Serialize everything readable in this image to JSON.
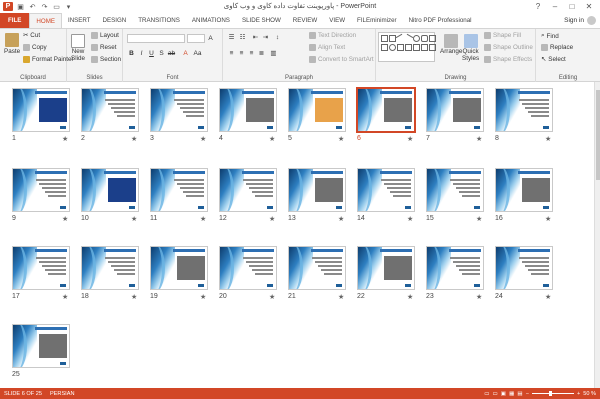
{
  "titlebar": {
    "app_icon": "P",
    "title": "پاورپوینت تفاوت داده کاوی و وب کاوی - PowerPoint",
    "window_controls": [
      "?",
      "–",
      "□",
      "✕"
    ]
  },
  "tabs": [
    {
      "label": "FILE"
    },
    {
      "label": "HOME"
    },
    {
      "label": "INSERT"
    },
    {
      "label": "DESIGN"
    },
    {
      "label": "TRANSITIONS"
    },
    {
      "label": "ANIMATIONS"
    },
    {
      "label": "SLIDE SHOW"
    },
    {
      "label": "REVIEW"
    },
    {
      "label": "VIEW"
    },
    {
      "label": "FILEminimizer"
    },
    {
      "label": "Nitro PDF Professional"
    }
  ],
  "signin": "Sign in",
  "ribbon": {
    "clipboard": {
      "paste": "Paste",
      "cut": "Cut",
      "copy": "Copy",
      "format_painter": "Format Painter",
      "label": "Clipboard"
    },
    "slides": {
      "new_slide": "New",
      "new_slide2": "Slide",
      "layout": "Layout",
      "reset": "Reset",
      "section": "Section",
      "label": "Slides"
    },
    "font": {
      "label": "Font"
    },
    "paragraph": {
      "text_direction": "Text Direction",
      "align_text": "Align Text",
      "convert": "Convert to SmartArt",
      "label": "Paragraph"
    },
    "drawing": {
      "arrange": "Arrange",
      "quick_styles": "Quick",
      "quick_styles2": "Styles",
      "shape_fill": "Shape Fill",
      "shape_outline": "Shape Outline",
      "shape_effects": "Shape Effects",
      "label": "Drawing"
    },
    "editing": {
      "find": "Find",
      "replace": "Replace",
      "select": "Select",
      "label": "Editing"
    }
  },
  "slides": [
    {
      "num": "1"
    },
    {
      "num": "2"
    },
    {
      "num": "3"
    },
    {
      "num": "4"
    },
    {
      "num": "5"
    },
    {
      "num": "6"
    },
    {
      "num": "7"
    },
    {
      "num": "8"
    },
    {
      "num": "9"
    },
    {
      "num": "10"
    },
    {
      "num": "11"
    },
    {
      "num": "12"
    },
    {
      "num": "13"
    },
    {
      "num": "14"
    },
    {
      "num": "15"
    },
    {
      "num": "16"
    },
    {
      "num": "17"
    },
    {
      "num": "18"
    },
    {
      "num": "19"
    },
    {
      "num": "20"
    },
    {
      "num": "21"
    },
    {
      "num": "22"
    },
    {
      "num": "23"
    },
    {
      "num": "24"
    },
    {
      "num": "25"
    }
  ],
  "selected_slide": "6",
  "status": {
    "slide_of": "SLIDE 6 OF 25",
    "language": "PERSIAN",
    "zoom": "50 %"
  },
  "colors": {
    "accent": "#d24726"
  }
}
